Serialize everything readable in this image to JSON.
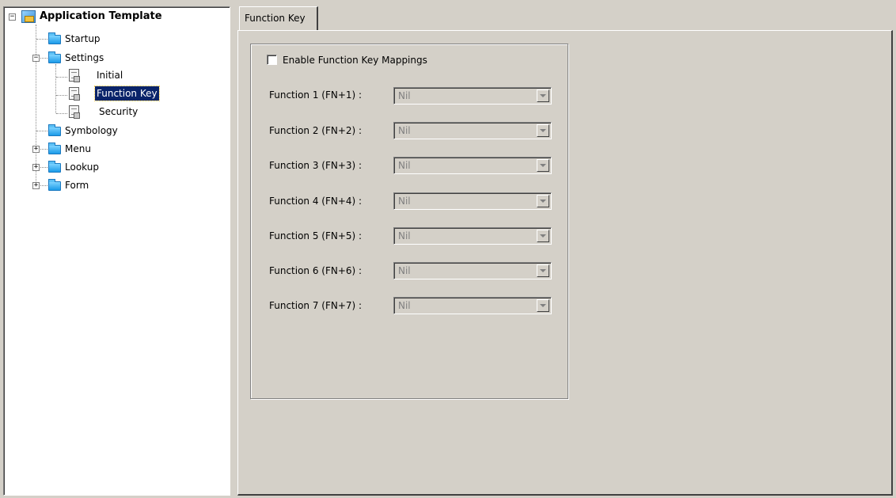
{
  "tree": {
    "root": {
      "label": "Application Template",
      "icon": "application-icon"
    },
    "items": [
      {
        "label": "Startup",
        "icon": "folder-icon"
      },
      {
        "label": "Settings",
        "icon": "folder-icon",
        "children": [
          {
            "label": "Initial",
            "icon": "document-icon"
          },
          {
            "label": "Function Key",
            "icon": "document-icon",
            "selected": true
          },
          {
            "label": "Security",
            "icon": "document-icon"
          }
        ]
      },
      {
        "label": "Symbology",
        "icon": "folder-icon"
      },
      {
        "label": "Menu",
        "icon": "folder-icon"
      },
      {
        "label": "Lookup",
        "icon": "folder-icon"
      },
      {
        "label": "Form",
        "icon": "folder-icon"
      }
    ],
    "expander_collapsed": "+",
    "expander_expanded": "−"
  },
  "tabs": [
    {
      "label": "Function Key",
      "active": true
    }
  ],
  "panel": {
    "enable_label": "Enable Function Key Mappings",
    "enable_checked": false,
    "functions": [
      {
        "label": "Function 1 (FN+1) :",
        "value": "Nil"
      },
      {
        "label": "Function 2 (FN+2) :",
        "value": "Nil"
      },
      {
        "label": "Function 3 (FN+3) :",
        "value": "Nil"
      },
      {
        "label": "Function 4 (FN+4) :",
        "value": "Nil"
      },
      {
        "label": "Function 5 (FN+5) :",
        "value": "Nil"
      },
      {
        "label": "Function 6 (FN+6) :",
        "value": "Nil"
      },
      {
        "label": "Function 7 (FN+7) :",
        "value": "Nil"
      }
    ]
  },
  "colors": {
    "window_bg": "#d4d0c8",
    "selection_bg": "#0a246a",
    "disabled_text": "#808080"
  }
}
